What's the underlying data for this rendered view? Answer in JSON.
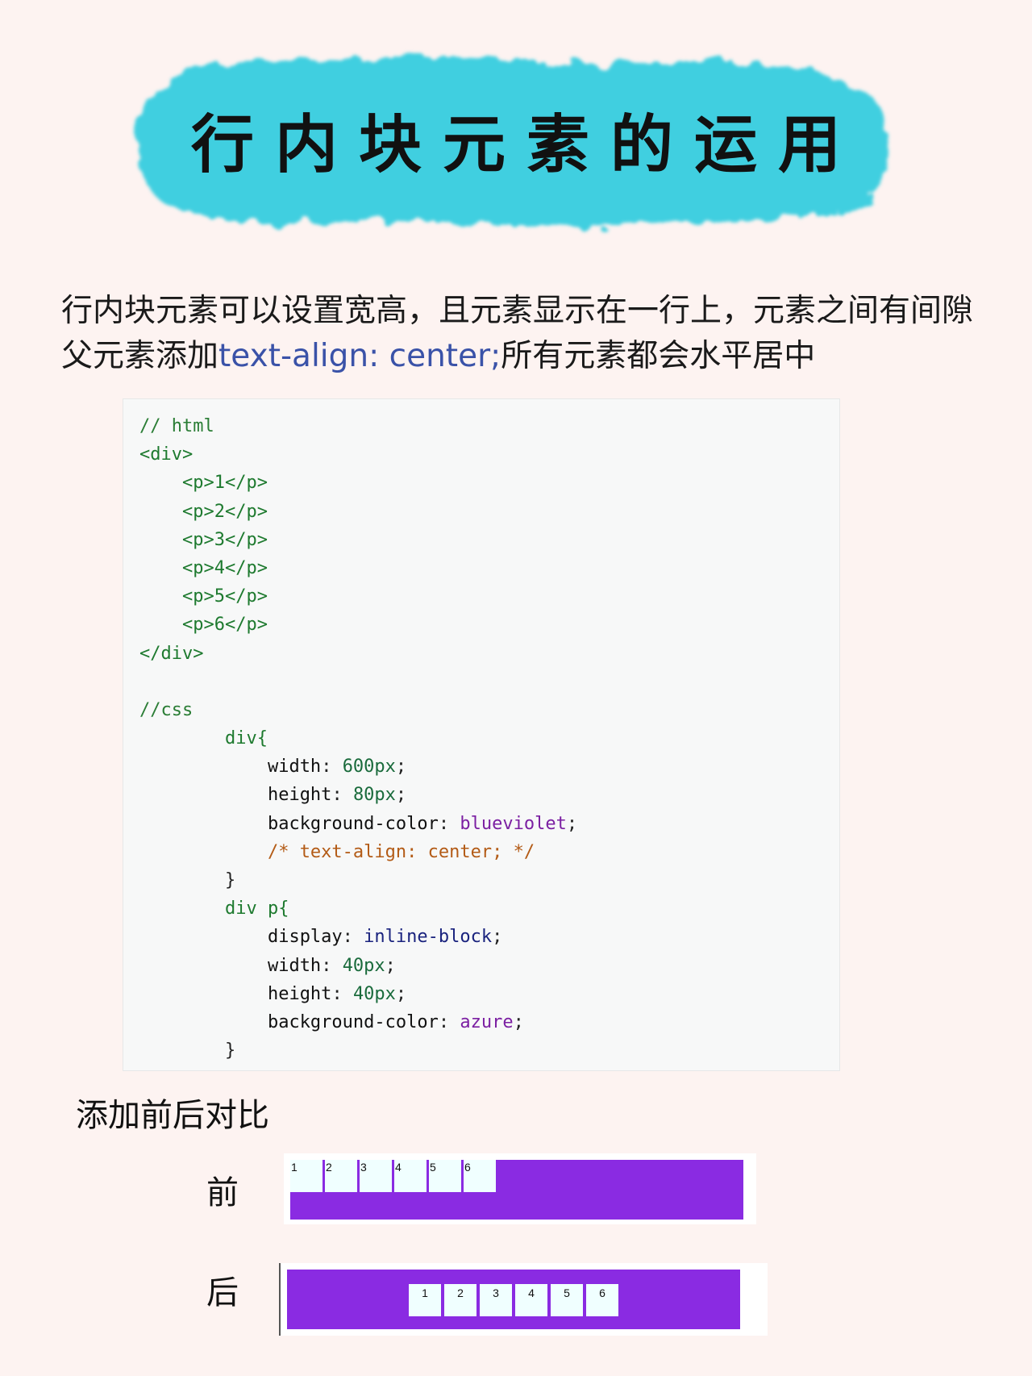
{
  "banner": {
    "title": "行内块元素的运用"
  },
  "intro": {
    "line1": "行内块元素可以设置宽高，且元素显示在一行上，元素之间有间隙",
    "line2_prefix": "父元素添加",
    "line2_code": "text-align: center;",
    "line2_suffix": "所有元素都会水平居中"
  },
  "code": {
    "html_comment": "// html",
    "div_open": "<div>",
    "p_items": [
      "<p>1</p>",
      "<p>2</p>",
      "<p>3</p>",
      "<p>4</p>",
      "<p>5</p>",
      "<p>6</p>"
    ],
    "div_close": "</div>",
    "css_comment": "//css",
    "rule1_selector": "div{",
    "width_prop": "width",
    "width_val": "600px",
    "height_prop": "height",
    "height_val": "80px",
    "bg_prop": "background-color",
    "bg_val": "blueviolet",
    "commented": "/* text-align: center; */",
    "close_brace": "}",
    "rule2_selector": "div p{",
    "display_prop": "display",
    "display_val": "inline-block",
    "p_width_val": "40px",
    "p_height_val": "40px",
    "p_bg_val": "azure"
  },
  "compare": {
    "title": "添加前后对比",
    "before_label": "前",
    "after_label": "后",
    "boxes": [
      "1",
      "2",
      "3",
      "4",
      "5",
      "6"
    ]
  },
  "colors": {
    "page_bg": "#fdf3f1",
    "banner": "#3fcfe0",
    "demo_parent": "#8a2be2",
    "demo_child": "#f0ffff",
    "highlight": "#3a52a8"
  }
}
